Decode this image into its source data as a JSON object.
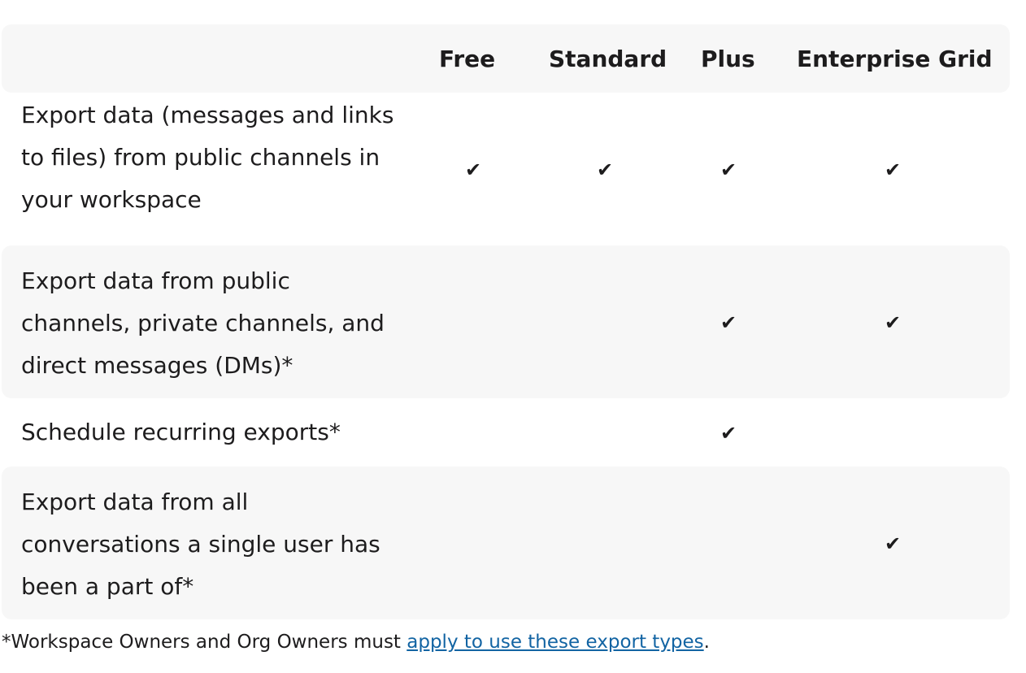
{
  "columns": [
    "Free",
    "Standard",
    "Plus",
    "Enterprise Grid"
  ],
  "check_glyph": "✔",
  "rows": [
    {
      "feature": "Export data (messages and links to files) from public channels in your workspace",
      "free": true,
      "standard": true,
      "plus": true,
      "enterprise_grid": true
    },
    {
      "feature": "Export data from public channels, private channels, and direct messages (DMs)*",
      "free": false,
      "standard": false,
      "plus": true,
      "enterprise_grid": true
    },
    {
      "feature": "Schedule recurring exports*",
      "free": false,
      "standard": false,
      "plus": true,
      "enterprise_grid": false
    },
    {
      "feature": "Export data from all conversations a single user has been a part of*",
      "free": false,
      "standard": false,
      "plus": false,
      "enterprise_grid": true
    }
  ],
  "footnote": {
    "prefix": "*Workspace Owners and Org Owners must ",
    "link_text": "apply to use these export types",
    "suffix": "."
  },
  "colors": {
    "shaded_row": "#f7f7f7",
    "text": "#1d1c1d",
    "link": "#1264a3"
  }
}
